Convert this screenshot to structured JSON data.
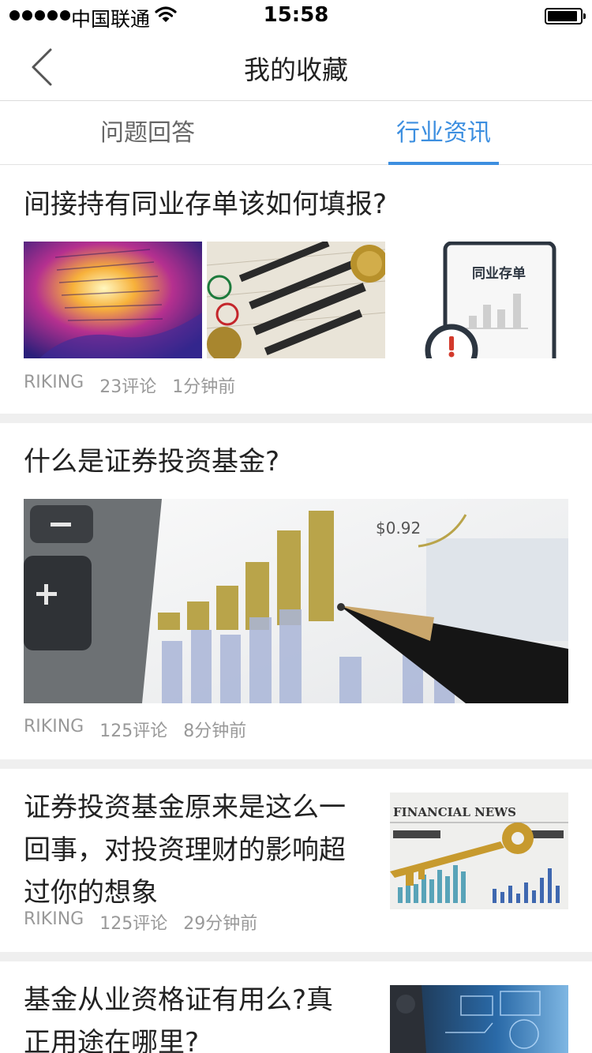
{
  "status_bar": {
    "carrier": "中国联通",
    "time": "15:58"
  },
  "nav": {
    "title": "我的收藏"
  },
  "tabs": [
    {
      "label": "问题回答",
      "active": false
    },
    {
      "label": "行业资讯",
      "active": true
    }
  ],
  "colors": {
    "accent": "#3d8fe0",
    "meta_text": "#999999",
    "divider": "#efefef"
  },
  "articles": [
    {
      "title": "间接持有同业存单该如何填报?",
      "author": "RIKING",
      "comments": "23评论",
      "time": "1分钟前",
      "images": [
        "receipt-paper-photo",
        "bank-logos-coins-photo",
        "interbank-cd-illustration"
      ],
      "illustration_text": "同业存单"
    },
    {
      "title": "什么是证券投资基金?",
      "author": "RIKING",
      "comments": "125评论",
      "time": "8分钟前",
      "images": [
        "calculator-chart-pen-photo"
      ],
      "photo_text": "$0.92"
    },
    {
      "title_lines": [
        "证券投资基金原来是这么一",
        "回事，对投资理财的影响超",
        "过你的想象"
      ],
      "author": "RIKING",
      "comments": "125评论",
      "time": "29分钟前",
      "images": [
        "financial-news-key-photo"
      ],
      "photo_text": "FINANCIAL NEWS"
    },
    {
      "title_lines": [
        "基金从业资格证有用么?真",
        "正用途在哪里?"
      ],
      "images": [
        "business-tech-photo"
      ]
    }
  ]
}
